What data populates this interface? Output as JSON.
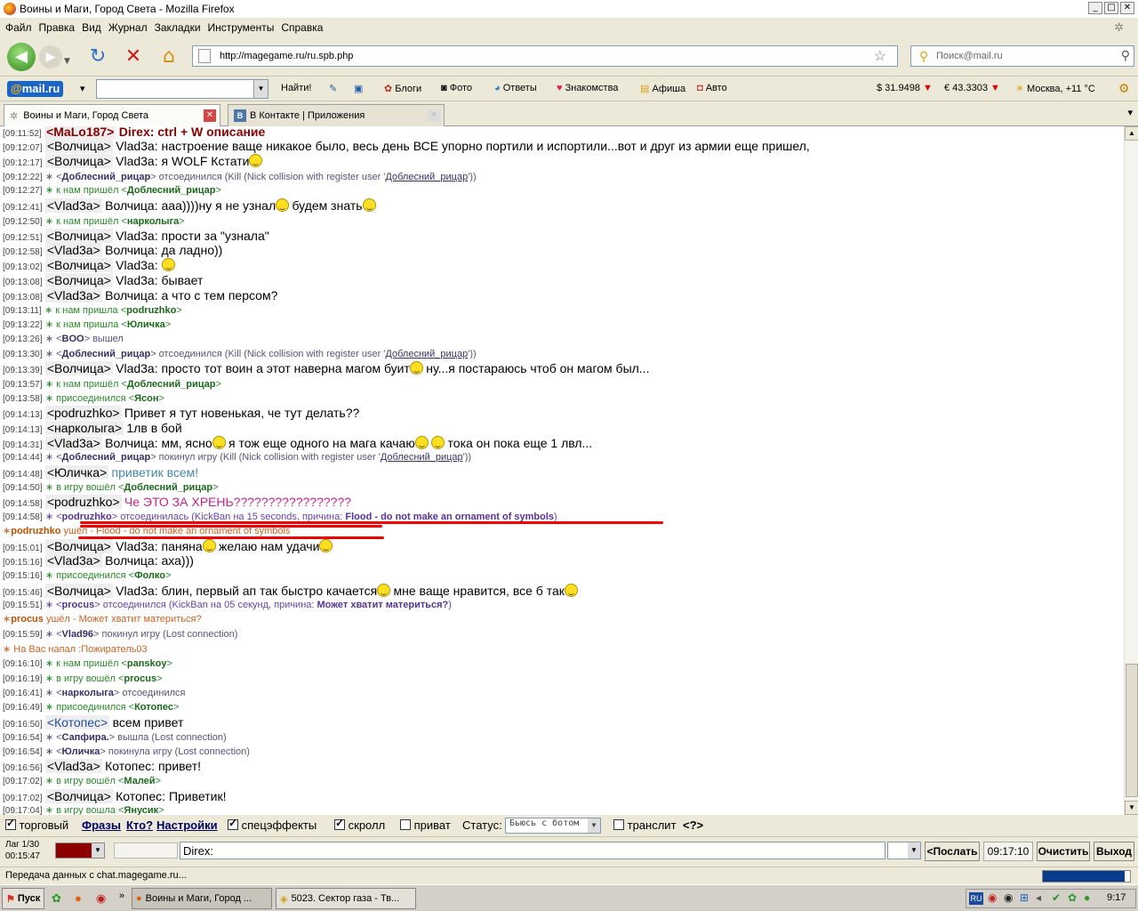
{
  "window": {
    "title": "Воины и Маги, Город Света - Mozilla Firefox"
  },
  "menu": [
    "Файл",
    "Правка",
    "Вид",
    "Журнал",
    "Закладки",
    "Инструменты",
    "Справка"
  ],
  "nav": {
    "url": "http://magegame.ru/ru.spb.php",
    "search_placeholder": "Поиск@mail.ru"
  },
  "mailbar": {
    "logo_at": "@",
    "logo_text": "mail.ru",
    "find": "Найти!",
    "blogs": "Блоги",
    "photo": "Фото",
    "answers": "Ответы",
    "dating": "Знакомства",
    "poster": "Афиша",
    "auto": "Авто",
    "usd": "$ 31.9498",
    "eur": "€ 43.3303",
    "weather": "Москва, +11 °С"
  },
  "tabs": [
    {
      "label": "Воины и Маги, Город Света"
    },
    {
      "label": "В Контакте | Приложения"
    }
  ],
  "chat": [
    {
      "t": "[09:11:52]",
      "k": "clip",
      "nick": "<MaLo187>",
      "text": "Direx: ctrl + W описание"
    },
    {
      "t": "[09:12:07]",
      "k": "msg",
      "nick": "<Волчица>",
      "text": "Vlad3a: настроение ваще никакое было, весь день ВСЕ упорно портили и испортили...вот и друг из армии еще пришел,"
    },
    {
      "t": "[09:12:17]",
      "k": "msg",
      "nick": "<Волчица>",
      "text": "Vlad3a: я WOLF Кстати",
      "s1": true
    },
    {
      "t": "[09:12:22]",
      "k": "sys",
      "a": "<",
      "n": "Доблесний_рицар",
      "b": "> отсоединился (Kill (Nick collision with register user '",
      "l": "Доблесний_рицар",
      "c": "'))"
    },
    {
      "t": "[09:12:27]",
      "k": "enter",
      "a": "к нам пришёл <",
      "n": "Доблесний_рицар",
      "b": ">"
    },
    {
      "t": "[09:12:41]",
      "k": "msg",
      "nick": "<Vlad3a>",
      "text": "Волчица: ааа))))ну я не узнал",
      "s1": true,
      "text2": "будем знать",
      "s2": true
    },
    {
      "t": "[09:12:50]",
      "k": "enter",
      "a": "к нам пришёл <",
      "n": "нарколыга",
      "b": ">"
    },
    {
      "t": "[09:12:51]",
      "k": "msg",
      "nick": "<Волчица>",
      "text": "Vlad3a: прости за \"узнала\""
    },
    {
      "t": "[09:12:58]",
      "k": "msg",
      "nick": "<Vlad3a>",
      "text": "Волчица: да ладно))"
    },
    {
      "t": "[09:13:02]",
      "k": "msg",
      "nick": "<Волчица>",
      "text": "Vlad3a: ",
      "s1": true
    },
    {
      "t": "[09:13:08]",
      "k": "msg",
      "nick": "<Волчица>",
      "text": "Vlad3a: бывает"
    },
    {
      "t": "[09:13:08]",
      "k": "msg",
      "nick": "<Vlad3a>",
      "text": "Волчица: а что с тем персом?"
    },
    {
      "t": "[09:13:11]",
      "k": "enter",
      "a": "к нам пришла <",
      "n": "podruzhko",
      "b": ">"
    },
    {
      "t": "[09:13:22]",
      "k": "enter",
      "a": "к нам пришла <",
      "n": "Юличка",
      "b": ">"
    },
    {
      "t": "[09:13:26]",
      "k": "sys",
      "a": "<",
      "n": "BOO",
      "b": "> вышел"
    },
    {
      "t": "[09:13:30]",
      "k": "sys",
      "a": "<",
      "n": "Доблесний_рицар",
      "b": "> отсоединился (Kill (Nick collision with register user '",
      "l": "Доблесний_рицар",
      "c": "'))"
    },
    {
      "t": "[09:13:39]",
      "k": "msg",
      "nick": "<Волчица>",
      "text": "Vlad3a: просто тот воин а этот наверна магом буит",
      "s1": true,
      "text2": "ну...я постараюсь чтоб он магом был..."
    },
    {
      "t": "[09:13:57]",
      "k": "enter",
      "a": "к нам пришёл <",
      "n": "Доблесний_рицар",
      "b": ">"
    },
    {
      "t": "[09:13:58]",
      "k": "enter",
      "a": "присоединился <",
      "n": "Ясон",
      "b": ">"
    },
    {
      "t": "[09:14:13]",
      "k": "msg",
      "nick": "<podruzhko>",
      "text": "Привет я тут новенькая, че тут делать??"
    },
    {
      "t": "[09:14:13]",
      "k": "msg",
      "nick": "<нарколыга>",
      "text": "1лв в бой"
    },
    {
      "t": "[09:14:31]",
      "k": "msg",
      "nick": "<Vlad3a>",
      "text": "Волчица: мм, ясно",
      "s1": true,
      "text2": "я тож еще одного на мага качаю",
      "s2": true,
      "s3": true,
      "text3": "тока он пока еще 1 лвл..."
    },
    {
      "t": "[09:14:44]",
      "k": "sys",
      "a": "<",
      "n": "Доблесний_рицар",
      "b": "> покинул игру (Kill (Nick collision with register user '",
      "l": "Доблесний_рицар",
      "c": "'))"
    },
    {
      "t": "[09:14:48]",
      "k": "msgc",
      "nick": "<Юличка>",
      "text": "приветик всем!",
      "cls": "teal"
    },
    {
      "t": "[09:14:50]",
      "k": "enter",
      "a": "в игру вошёл <",
      "n": "Доблесний_рицар",
      "b": ">"
    },
    {
      "t": "[09:14:58]",
      "k": "msgc",
      "nick": "<podruzhko>",
      "text": "Че ЭТО ЗА ХРЕНЬ?????????????????",
      "cls": "pink"
    },
    {
      "t": "[09:14:58]",
      "k": "kick",
      "a": "<",
      "n": "podruzhko",
      "b": "> отсоединилась (KickBan на 15 seconds, причина: ",
      "r": "Flood - do not make an ornament of symbols",
      ")": ")"
    },
    {
      "t": "",
      "k": "exit",
      "n": "podruzhko",
      "b": " ушёл - Flood - do not make an ornament of symbols"
    },
    {
      "t": "[09:15:01]",
      "k": "msg",
      "nick": "<Волчица>",
      "text": "Vlad3a: паняна",
      "s1": true,
      "text2": "желаю нам удачи",
      "s2": true
    },
    {
      "t": "[09:15:16]",
      "k": "msg",
      "nick": "<Vlad3a>",
      "text": "Волчица: аха)))"
    },
    {
      "t": "[09:15:16]",
      "k": "enter",
      "a": "присоединился <",
      "n": "Фолко",
      "b": ">"
    },
    {
      "t": "[09:15:46]",
      "k": "msg",
      "nick": "<Волчица>",
      "text": "Vlad3a: блин, первый ап так быстро качается",
      "s1": true,
      "text2": "мне ваще нравится, все б так",
      "s2": true
    },
    {
      "t": "[09:15:51]",
      "k": "kick",
      "a": "<",
      "n": "procus",
      "b": "> отсоединился (KickBan на 05 секунд, причина: ",
      "r": "Может хватит материться?",
      ")": ")"
    },
    {
      "t": "",
      "k": "exit",
      "n": "procus",
      "b": " ушёл - Может хватит материться?"
    },
    {
      "t": "[09:15:59]",
      "k": "sys",
      "a": "<",
      "n": "Vlad96",
      "b": "> покинул игру (Lost connection)"
    },
    {
      "t": "",
      "k": "attack",
      "b": "На Вас напал :Пожиратель03"
    },
    {
      "t": "[09:16:10]",
      "k": "enter",
      "a": "к нам пришёл <",
      "n": "panskoy",
      "b": ">"
    },
    {
      "t": "[09:16:19]",
      "k": "enter",
      "a": "в игру вошёл <",
      "n": "procus",
      "b": ">"
    },
    {
      "t": "[09:16:41]",
      "k": "sys",
      "a": "<",
      "n": "нарколыга",
      "b": "> отсоединился"
    },
    {
      "t": "[09:16:49]",
      "k": "enter",
      "a": "присоединился <",
      "n": "Котопес",
      "b": ">"
    },
    {
      "t": "[09:16:50]",
      "k": "msgb",
      "nick": "<Котопес>",
      "text": "всем привет"
    },
    {
      "t": "[09:16:54]",
      "k": "sys",
      "a": "<",
      "n": "Сапфира.",
      "b": "> вышла (Lost connection)"
    },
    {
      "t": "[09:16:54]",
      "k": "sys",
      "a": "<",
      "n": "Юличка",
      "b": "> покинула игру (Lost connection)"
    },
    {
      "t": "[09:16:56]",
      "k": "msg",
      "nick": "<Vlad3a>",
      "text": "Котопес: привет!"
    },
    {
      "t": "[09:17:02]",
      "k": "enter",
      "a": "в игру вошёл <",
      "n": "Малей",
      "b": ">"
    },
    {
      "t": "[09:17:02]",
      "k": "msg",
      "nick": "<Волчица>",
      "text": "Котопес: Приветик!"
    },
    {
      "t": "[09:17:04]",
      "k": "enter",
      "a": "в игру вошла <",
      "n": "Янусик",
      "b": ">"
    }
  ],
  "options": {
    "trade": "торговый",
    "phrases": "Фразы",
    "who": "Кто?",
    "settings": "Настройки",
    "effects": "спецэффекты",
    "scroll": "скролл",
    "private": "приват",
    "status_label": "Статус:",
    "status_value": "Бьюсь с ботом",
    "translit": "транслит",
    "help": "<?>"
  },
  "input": {
    "lag": "Лаг 1/30",
    "clock": "00:15:47",
    "value": "Direx:",
    "send": "<Послать",
    "time": "09:17:10",
    "clear": "Очистить",
    "exit": "Выход"
  },
  "status": {
    "text": "Передача данных с chat.magegame.ru..."
  },
  "taskbar": {
    "start": "Пуск",
    "win1": "Воины и Маги, Город ...",
    "win2": "5023. Сектор газа - Тв...",
    "tray_lang": "RU",
    "clock": "9:17"
  },
  "colors": {
    "accent": "#1a66c8",
    "underline": "#ee0000"
  }
}
